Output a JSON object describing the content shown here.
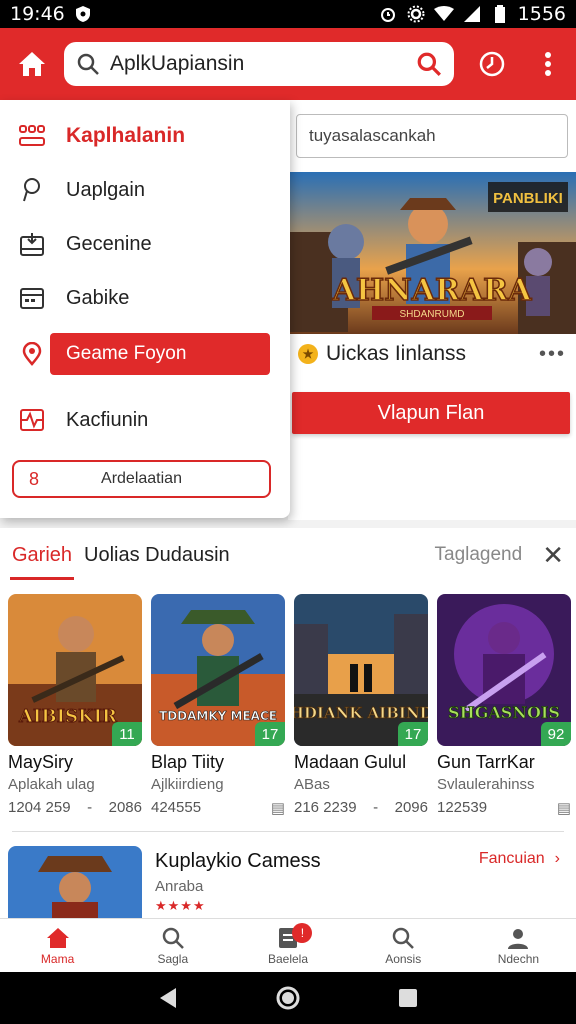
{
  "status_bar": {
    "time": "19:46",
    "battery_time": "1556",
    "icons": [
      "shield-icon",
      "alarm-icon",
      "settings-icon",
      "wifi-icon",
      "signal-icon",
      "battery-icon"
    ]
  },
  "toolbar": {
    "search_value": "AplkUapiansin",
    "icons": [
      "home-icon",
      "search-icon",
      "clock-icon",
      "more-vertical-icon"
    ]
  },
  "drawer": {
    "items": [
      {
        "label": "Kaplhalanin",
        "icon": "grid-icon"
      },
      {
        "label": "Uaplgain",
        "icon": "location-pin-icon"
      },
      {
        "label": "Gecenine",
        "icon": "tray-icon"
      },
      {
        "label": "Gabike",
        "icon": "calendar-icon"
      },
      {
        "label": "Geame Foyon",
        "icon": "location-pin-icon"
      },
      {
        "label": "Kacfiunin",
        "icon": "activity-icon"
      }
    ],
    "button_number": "8",
    "button_label": "Ardelaatian"
  },
  "right_panel": {
    "search_placeholder": "tuyasalascankah",
    "banner_title": "AHNARARA",
    "banner_subtitle": "SHDANRUMD",
    "banner_tag": "PANBLIKI",
    "title": "Uickas Iinlanss",
    "button_label": "Vlapun Flan"
  },
  "section": {
    "tab_active": "Garieh",
    "tab_second": "Uolias Dudausin",
    "right_label": "Taglagend",
    "cards": [
      {
        "name": "MaySiry",
        "sub": "Aplakah ulag",
        "meta_left": "1204 259",
        "meta_right": "2086",
        "badge": "11",
        "art_title": "AIBISKIR"
      },
      {
        "name": "Blap Tiity",
        "sub": "Ajlkiirdieng",
        "meta_left": "424555",
        "meta_right": "",
        "badge": "17",
        "art_title": "TDDAMKY MEACE"
      },
      {
        "name": "Madaan Gulul",
        "sub": "ABas",
        "meta_left": "216 2239",
        "meta_right": "2096",
        "badge": "17",
        "art_title": "THDIANK AIBINDS"
      },
      {
        "name": "Gun TarrKar",
        "sub": "Svlaulerahinss",
        "meta_left": "122539",
        "meta_right": "",
        "badge": "92",
        "art_title": "SHGASNOIS"
      }
    ],
    "featured": {
      "title": "Kuplaykio Camess",
      "sub": "Anraba",
      "stars": "★★★★",
      "link": "Fancuian"
    }
  },
  "bottom_nav": {
    "items": [
      {
        "label": "Mama",
        "icon": "home-icon"
      },
      {
        "label": "Sagla",
        "icon": "search-icon"
      },
      {
        "label": "Baelela",
        "icon": "document-icon"
      },
      {
        "label": "Aonsis",
        "icon": "search-icon"
      },
      {
        "label": "Ndechn",
        "icon": "person-icon"
      }
    ],
    "badge": "!"
  },
  "colors": {
    "accent": "#e02a2a",
    "badge_green": "#34a853"
  }
}
